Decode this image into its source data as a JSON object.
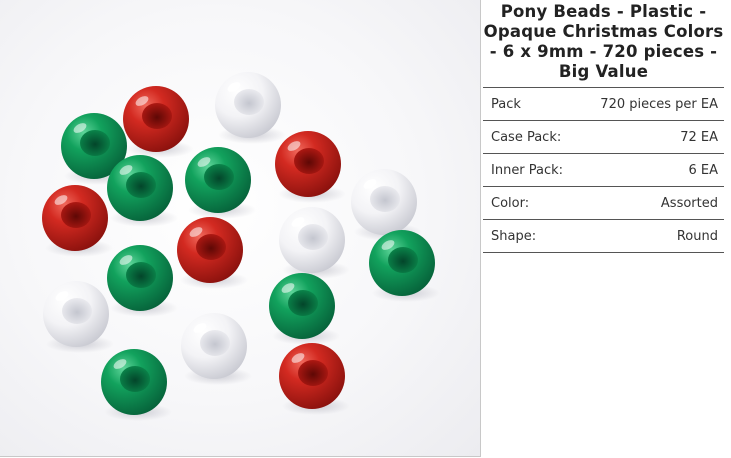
{
  "product": {
    "title": "Pony Beads - Plastic - Opaque Christmas Colors - 6 x 9mm - 720 pieces - Big Value",
    "image_alt": "Red, green and white opaque pony beads"
  },
  "specs": [
    {
      "label": "Pack",
      "value": "720 pieces per EA"
    },
    {
      "label": "Case Pack:",
      "value": "72 EA"
    },
    {
      "label": "Inner Pack:",
      "value": "6 EA"
    },
    {
      "label": "Color:",
      "value": "Assorted"
    },
    {
      "label": "Shape:",
      "value": "Round"
    }
  ],
  "colors": {
    "red": "#c8211b",
    "green": "#0d9b57",
    "white": "#f4f4f6",
    "divider": "#555555"
  }
}
